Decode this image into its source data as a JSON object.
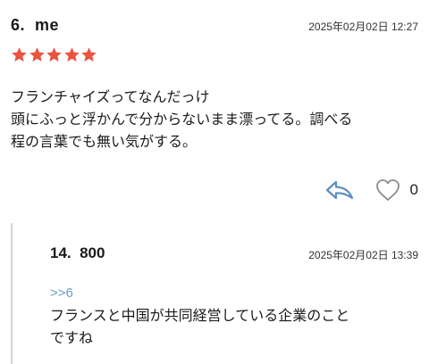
{
  "comment": {
    "number": "6.",
    "author": "me",
    "date": "2025年02月02日 12:27",
    "rating": 5,
    "star_color": "#e9543e",
    "body_lines": [
      "フランチャイズってなんだっけ",
      "頭にふっと浮かんで分からないまま漂ってる。調べる",
      "程の言葉でも無い気がする。"
    ],
    "reply_icon": "reply-arrow-icon",
    "like_icon": "heart-outline-icon",
    "like_count": "0",
    "reply_icon_color": "#5b8fbf"
  },
  "reply": {
    "number": "14.",
    "author": "800",
    "date": "2025年02月02日 13:39",
    "anchor": ">>6",
    "anchor_color": "#6a9ec2",
    "body_lines": [
      "フランスと中国が共同経営している企業のこと",
      "ですね"
    ]
  }
}
